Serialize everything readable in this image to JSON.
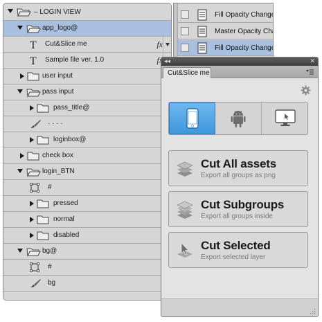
{
  "layers_panel": {
    "rows": [
      {
        "label": "– LOGIN VIEW",
        "kind": "group",
        "open": true,
        "selected": false
      },
      {
        "label": "app_logo@",
        "kind": "group",
        "open": true,
        "selected": true
      },
      {
        "label": "Cut&Slice me",
        "kind": "text",
        "fx": "fx"
      },
      {
        "label": "Sample file ver. 1.0",
        "kind": "text",
        "fx": "fx"
      },
      {
        "label": "user input",
        "kind": "group",
        "open": false
      },
      {
        "label": "pass input",
        "kind": "group",
        "open": true
      },
      {
        "label": "pass_title@",
        "kind": "group",
        "open": false
      },
      {
        "label": "· · · ·",
        "kind": "brush"
      },
      {
        "label": "loginbox@",
        "kind": "group",
        "open": false
      },
      {
        "label": "check box",
        "kind": "group",
        "open": false
      },
      {
        "label": "login_BTN",
        "kind": "group",
        "open": true
      },
      {
        "label": "#",
        "kind": "shape"
      },
      {
        "label": "pressed",
        "kind": "group",
        "open": false
      },
      {
        "label": "normal",
        "kind": "group",
        "open": false
      },
      {
        "label": "disabled",
        "kind": "group",
        "open": false
      },
      {
        "label": "bg@",
        "kind": "group",
        "open": true
      },
      {
        "label": "#",
        "kind": "shape"
      },
      {
        "label": "bg",
        "kind": "brush"
      }
    ]
  },
  "history_panel": {
    "rows": [
      {
        "label": "Fill Opacity Change",
        "selected": false
      },
      {
        "label": "Master Opacity Change",
        "selected": false
      },
      {
        "label": "Fill Opacity Change",
        "selected": true
      }
    ]
  },
  "cutslice_panel": {
    "collapse_glyph": "◂◂",
    "close_glyph": "✕",
    "tab_label": "Cut&Slice me",
    "platforms": [
      {
        "name": "ios",
        "icon": "phone-icon",
        "active": true
      },
      {
        "name": "android",
        "icon": "android-icon",
        "active": false
      },
      {
        "name": "desktop",
        "icon": "monitor-icon",
        "active": false
      }
    ],
    "actions": [
      {
        "title": "Cut All assets",
        "subtitle": "Export all groups as png",
        "icon": "layers-stack-icon"
      },
      {
        "title": "Cut Subgroups",
        "subtitle": "Export all groups inside",
        "icon": "layers-nested-icon"
      },
      {
        "title": "Cut Selected",
        "subtitle": "Export selected layer",
        "icon": "cursor-layer-icon"
      }
    ]
  },
  "colors": {
    "selection": "#a9bfe0",
    "panel_bg": "#d6d6d6",
    "active_platform": "#4aa0e3",
    "titlebar": "#4a4a4a"
  }
}
